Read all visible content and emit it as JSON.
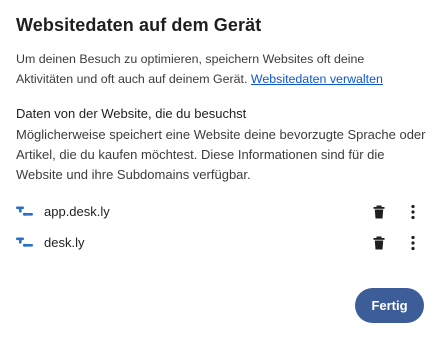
{
  "dialog": {
    "title": "Websitedaten auf dem Gerät",
    "intro_text": "Um deinen Besuch zu optimieren, speichern Websites oft deine Aktivitäten und oft auch auf deinem Gerät. ",
    "intro_link": "Websitedaten verwalten",
    "section_heading": "Daten von der Website, die du besuchst",
    "section_body": "Möglicherweise speichert eine Website deine bevorzugte Sprache oder Artikel, die du kaufen möchtest. Diese Informationen sind für die Website und ihre Subdomains verfügbar."
  },
  "sites": [
    {
      "name": "app.desk.ly",
      "icon": "desk-favicon-icon",
      "delete_icon": "trash-icon",
      "menu_icon": "more-vert-icon"
    },
    {
      "name": "desk.ly",
      "icon": "desk-favicon-icon",
      "delete_icon": "trash-icon",
      "menu_icon": "more-vert-icon"
    }
  ],
  "footer": {
    "done_label": "Fertig"
  },
  "colors": {
    "accent": "#3d5d98",
    "link": "#0b57d0",
    "favicon": "#2b6fc7"
  }
}
